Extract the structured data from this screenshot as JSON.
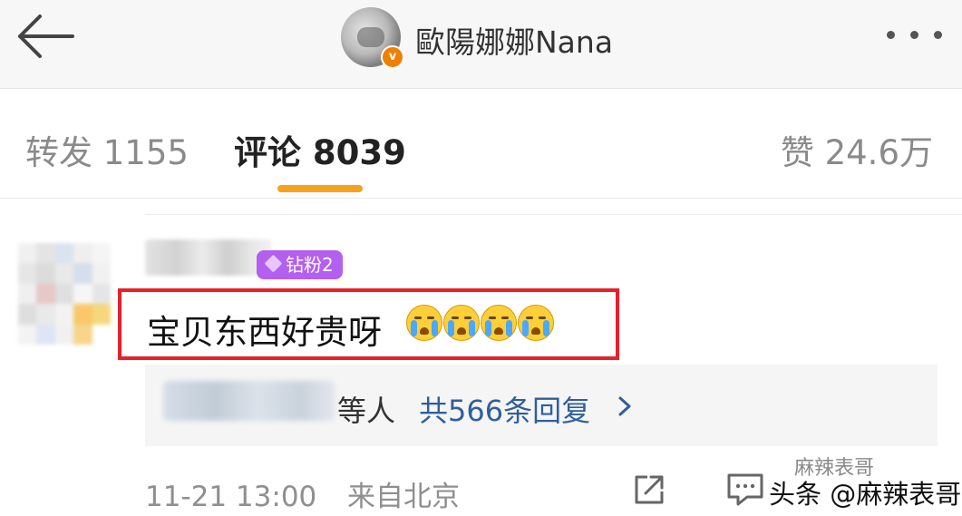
{
  "header": {
    "username": "歐陽娜娜Nana",
    "verified_badge": "v",
    "icons": {
      "back": "back-arrow-icon",
      "more": "more-dots-icon"
    }
  },
  "tabs": [
    {
      "label": "转发 1155"
    },
    {
      "label": "评论 8039"
    },
    {
      "label": "赞 24.6万"
    }
  ],
  "comment": {
    "fan_badge": "钻粉2",
    "text": "宝贝东西好贵呀",
    "emoji_count": 4,
    "emoji_icon": "crying-face-icon",
    "highlight_color": "#e8202a",
    "replies": {
      "suffix": "等人",
      "link": "共566条回复"
    },
    "time": "11-21 13:00",
    "source": "来自北京",
    "watermark_top": "麻辣表哥",
    "watermark": "头条 @麻辣表哥"
  },
  "colors": {
    "accent_underline": "#f7a21b",
    "link": "#2f5f9c",
    "badge": "#b35ff0"
  }
}
